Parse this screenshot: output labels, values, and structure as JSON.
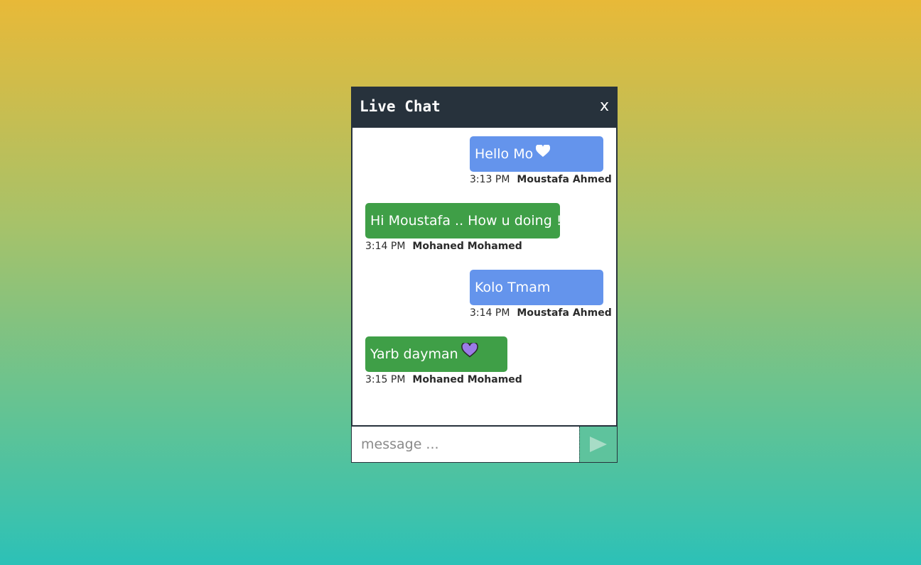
{
  "header": {
    "title": "Live Chat",
    "close_label": "x"
  },
  "messages": [
    {
      "side": "me",
      "text": "Hello Mo",
      "emoji": "white-heart-icon",
      "time": "3:13 PM",
      "author": "Moustafa Ahmed",
      "color": "#6494ec"
    },
    {
      "side": "them",
      "text": "Hi Moustafa .. How u doing !",
      "emoji": "",
      "time": "3:14 PM",
      "author": "Mohaned Mohamed",
      "color": "#3f9f47"
    },
    {
      "side": "me",
      "text": "Kolo Tmam",
      "emoji": "",
      "time": "3:14 PM",
      "author": "Moustafa Ahmed",
      "color": "#6494ec"
    },
    {
      "side": "them",
      "text": "Yarb dayman",
      "emoji": "purple-heart-icon",
      "time": "3:15 PM",
      "author": "Mohaned Mohamed",
      "color": "#3f9f47"
    }
  ],
  "composer": {
    "placeholder": "message ...",
    "value": "",
    "send_icon": "send-triangle-icon"
  },
  "colors": {
    "header_bg": "#27323c",
    "send_bg": "#5ec39d",
    "gradient_top": "#e8b938",
    "gradient_bottom": "#2cc1b7"
  }
}
